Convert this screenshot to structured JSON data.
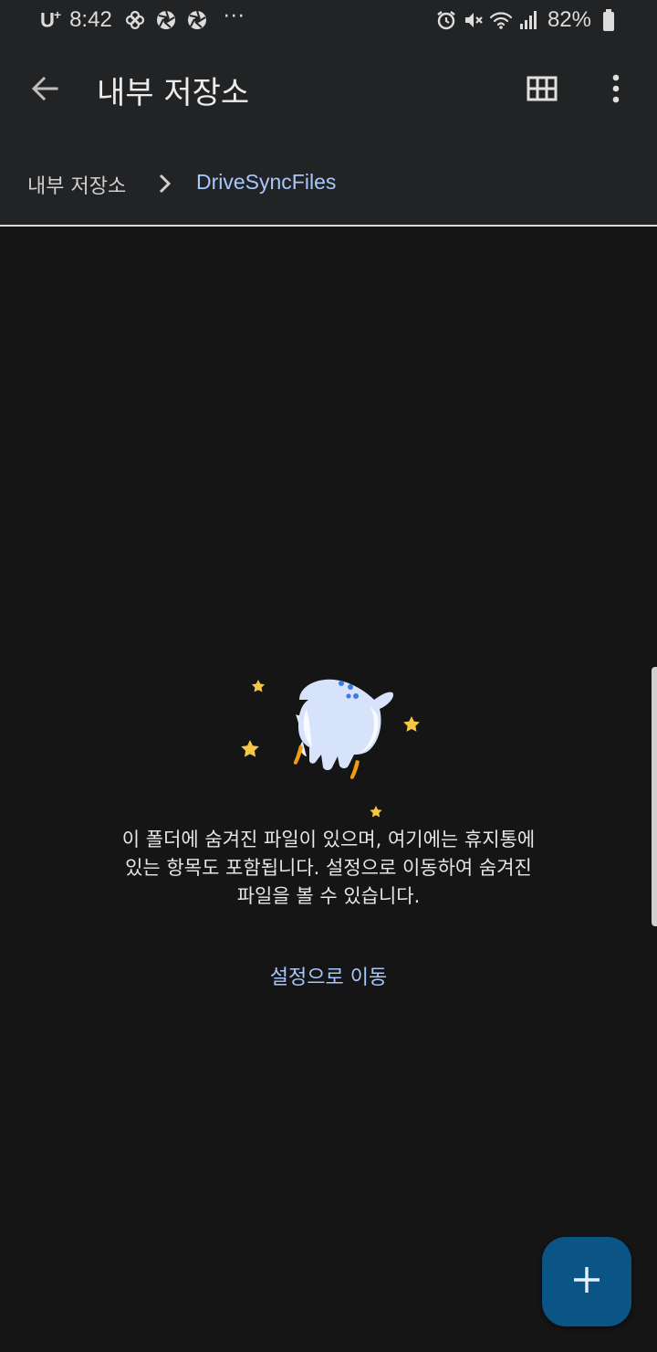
{
  "status_bar": {
    "carrier": "U",
    "carrier_sup": "+",
    "time": "8:42",
    "more_dots": "···",
    "battery_percent": "82%",
    "icons_left": [
      "pinwheel-icon",
      "shutter-icon",
      "shutter-icon"
    ],
    "icons_right": [
      "alarm-icon",
      "mute-icon",
      "wifi-icon",
      "signal-icon",
      "battery-icon"
    ]
  },
  "app_bar": {
    "title": "내부 저장소",
    "back_icon": "arrow-left-icon",
    "view_toggle_icon": "grid-view-icon",
    "menu_icon": "more-vert-icon"
  },
  "breadcrumb": {
    "items": [
      "내부 저장소",
      "DriveSyncFiles"
    ],
    "separator_icon": "chevron-right-icon"
  },
  "empty_state": {
    "illustration": "ghost-rocket-illustration",
    "message_lines": [
      "이 폴더에 숨겨진 파일이 있으며, 여기에는 휴지통에",
      "있는 항목도 포함됩니다. 설정으로 이동하여 숨겨진",
      "파일을 볼 수 있습니다."
    ],
    "action_label": "설정으로 이동"
  },
  "fab": {
    "icon": "plus-icon"
  },
  "colors": {
    "background": "#151516",
    "bar": "#222325",
    "accent": "#a8c7fa",
    "fab": "#0b5486",
    "star": "#f7c744",
    "flame": "#f39c12"
  }
}
